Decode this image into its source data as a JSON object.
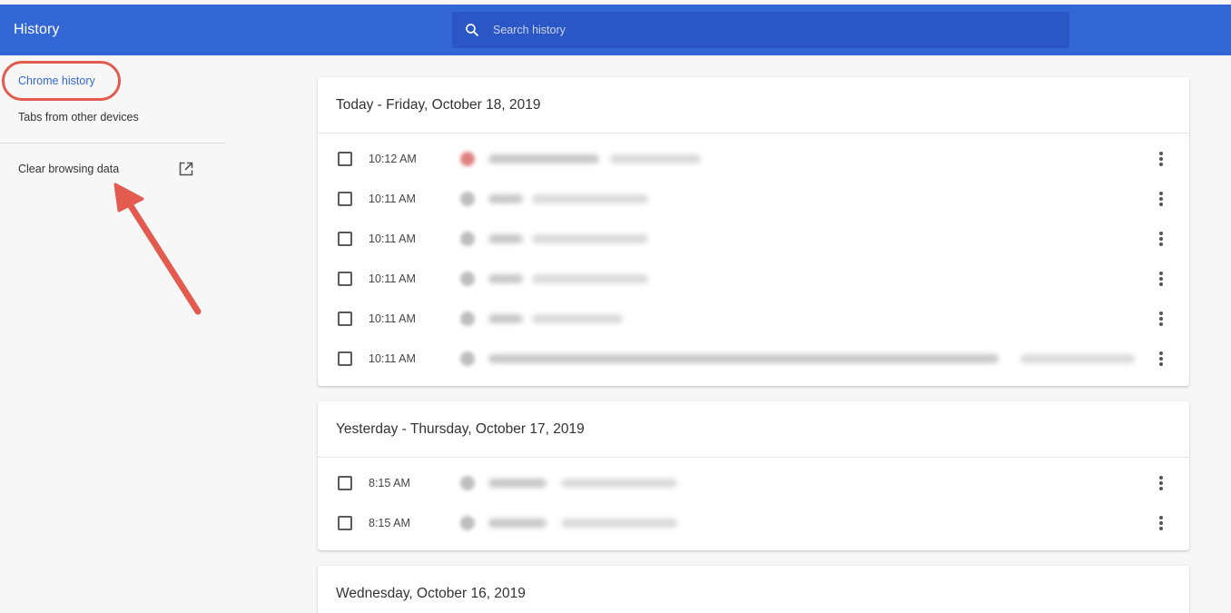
{
  "header": {
    "title": "History",
    "search_placeholder": "Search history"
  },
  "sidebar": {
    "items": [
      {
        "label": "Chrome history",
        "active": true
      },
      {
        "label": "Tabs from other devices",
        "active": false
      },
      {
        "label": "Clear browsing data",
        "active": false
      }
    ]
  },
  "days": [
    {
      "heading": "Today - Friday, October 18, 2019",
      "entries": [
        {
          "time": "10:12 AM"
        },
        {
          "time": "10:11 AM"
        },
        {
          "time": "10:11 AM"
        },
        {
          "time": "10:11 AM"
        },
        {
          "time": "10:11 AM"
        },
        {
          "time": "10:11 AM"
        }
      ]
    },
    {
      "heading": "Yesterday - Thursday, October 17, 2019",
      "entries": [
        {
          "time": "8:15 AM"
        },
        {
          "time": "8:15 AM"
        }
      ]
    },
    {
      "heading": "Wednesday, October 16, 2019",
      "entries": []
    }
  ],
  "colors": {
    "accent": "#3367d6",
    "annotation": "#e25b4e"
  }
}
